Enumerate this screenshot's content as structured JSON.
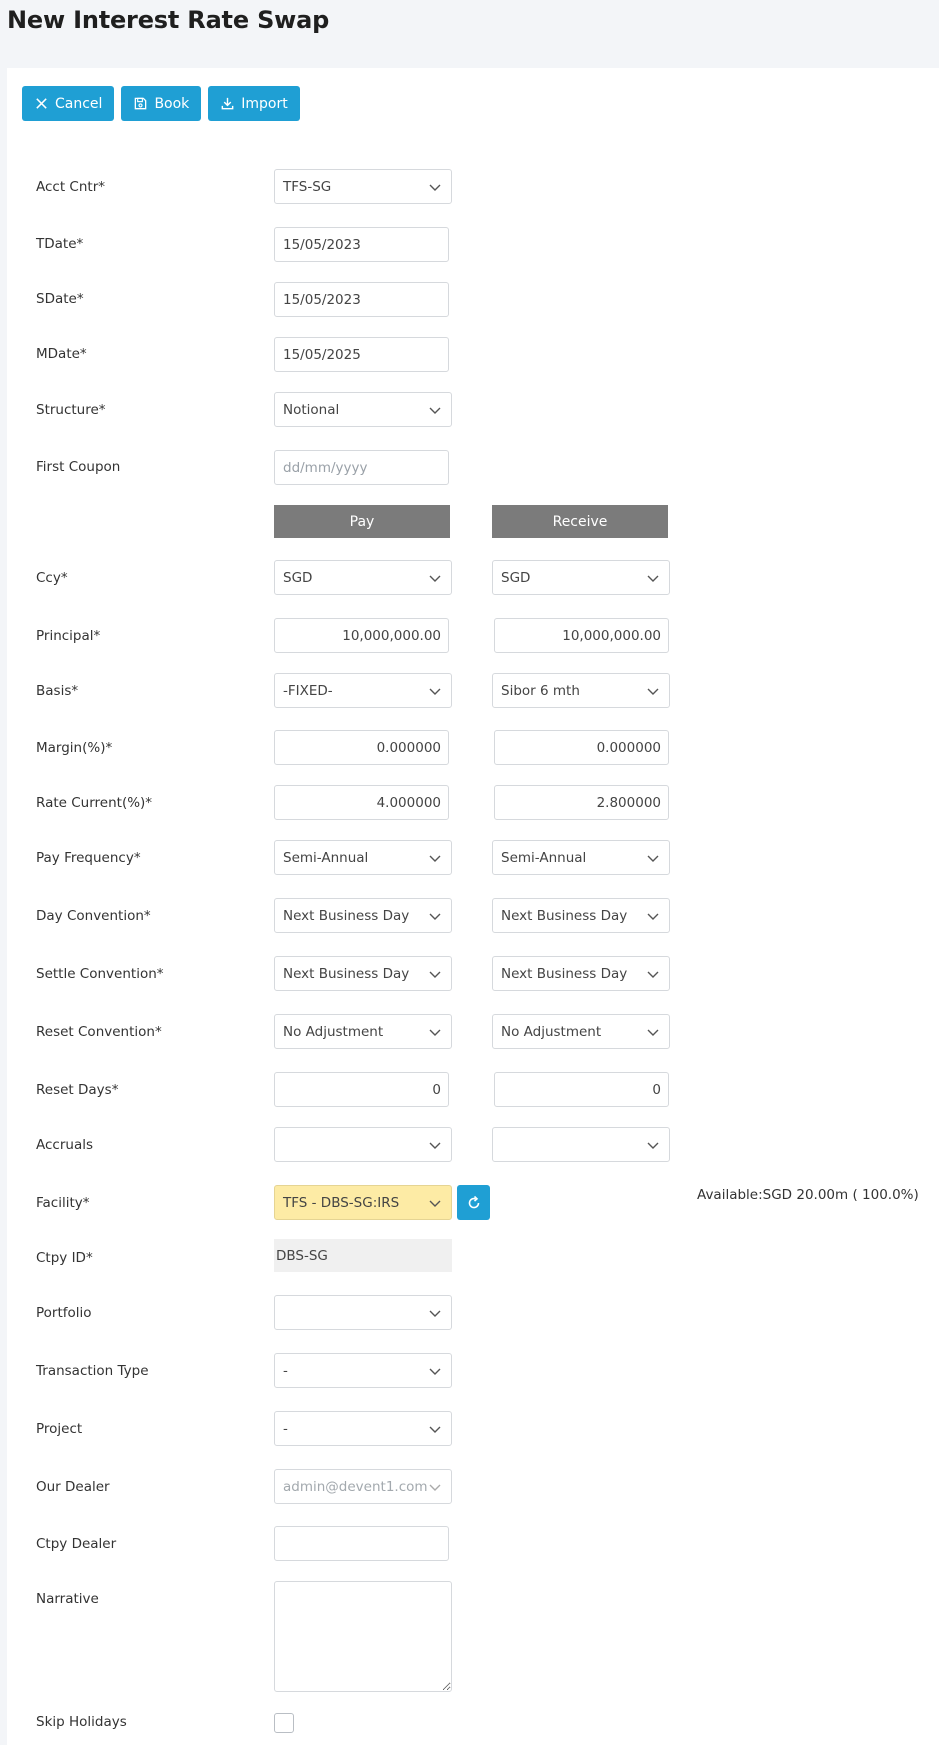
{
  "page": {
    "title": "New Interest Rate Swap"
  },
  "toolbar": {
    "cancel": "Cancel",
    "book": "Book",
    "import": "Import"
  },
  "labels": {
    "acct_cntr": "Acct Cntr*",
    "tdate": "TDate*",
    "sdate": "SDate*",
    "mdate": "MDate*",
    "structure": "Structure*",
    "first_coupon": "First Coupon",
    "ccy": "Ccy*",
    "principal": "Principal*",
    "basis": "Basis*",
    "margin": "Margin(%)*",
    "rate_current": "Rate Current(%)*",
    "pay_frequency": "Pay Frequency*",
    "day_convention": "Day Convention*",
    "settle_convention": "Settle Convention*",
    "reset_convention": "Reset Convention*",
    "reset_days": "Reset Days*",
    "accruals": "Accruals",
    "facility": "Facility*",
    "ctpy_id": "Ctpy ID*",
    "portfolio": "Portfolio",
    "transaction_type": "Transaction Type",
    "project": "Project",
    "our_dealer": "Our Dealer",
    "ctpy_dealer": "Ctpy Dealer",
    "narrative": "Narrative",
    "skip_holidays": "Skip Holidays"
  },
  "values": {
    "acct_cntr": "TFS-SG",
    "tdate": "15/05/2023",
    "sdate": "15/05/2023",
    "mdate": "15/05/2025",
    "structure": "Notional",
    "first_coupon_placeholder": "dd/mm/yyyy",
    "facility": "TFS - DBS-SG:IRS",
    "available": "Available:SGD 20.00m ( 100.0%)",
    "ctpy_id": "DBS-SG",
    "portfolio": "",
    "transaction_type": "-",
    "project": "-",
    "our_dealer": "admin@devent1.com",
    "ctpy_dealer": "",
    "narrative": "",
    "skip_holidays": false
  },
  "columns": {
    "pay": "Pay",
    "receive": "Receive"
  },
  "pay": {
    "ccy": "SGD",
    "principal": "10,000,000.00",
    "basis": "-FIXED-",
    "margin": "0.000000",
    "rate_current": "4.000000",
    "pay_frequency": "Semi-Annual",
    "day_convention": "Next Business Day",
    "settle_convention": "Next Business Day",
    "reset_convention": "No Adjustment",
    "reset_days": "0",
    "accruals": ""
  },
  "receive": {
    "ccy": "SGD",
    "principal": "10,000,000.00",
    "basis": "Sibor 6 mth",
    "margin": "0.000000",
    "rate_current": "2.800000",
    "pay_frequency": "Semi-Annual",
    "day_convention": "Next Business Day",
    "settle_convention": "Next Business Day",
    "reset_convention": "No Adjustment",
    "reset_days": "0",
    "accruals": ""
  },
  "icons": {
    "cancel": "close-icon",
    "book": "save-icon",
    "import": "download-icon",
    "dropdown": "chevron-down-icon",
    "refresh": "refresh-icon"
  },
  "colors": {
    "accent": "#1f9fd4",
    "column_header": "#7b7b7b",
    "facility_highlight": "#fdeba5",
    "page_bg": "#f3f5f8"
  }
}
